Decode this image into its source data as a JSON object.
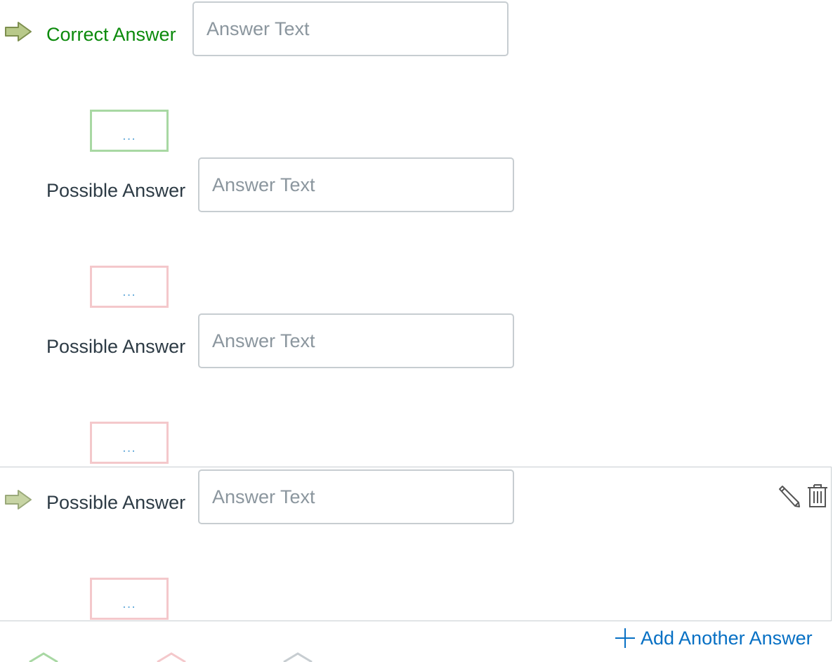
{
  "answers": [
    {
      "label": "Correct Answer",
      "placeholder": "Answer Text",
      "value": "",
      "correct": true
    },
    {
      "label": "Possible Answer",
      "placeholder": "Answer Text",
      "value": "",
      "correct": false
    },
    {
      "label": "Possible Answer",
      "placeholder": "Answer Text",
      "value": "",
      "correct": false
    },
    {
      "label": "Possible Answer",
      "placeholder": "Answer Text",
      "value": "",
      "correct": false
    }
  ],
  "comment_button_text": "...",
  "add_answer_label": "Add Another Answer",
  "icons": {
    "correct_arrow": "arrow-right-icon",
    "edit": "pencil-icon",
    "delete": "trash-icon",
    "add": "plus-icon"
  },
  "colors": {
    "correct": "#0b8a0b",
    "link": "#0770c4",
    "arrow_fill": "#b8c98a",
    "comment_green_border": "#a8d8a3",
    "comment_red_border": "#f4c8cb"
  }
}
